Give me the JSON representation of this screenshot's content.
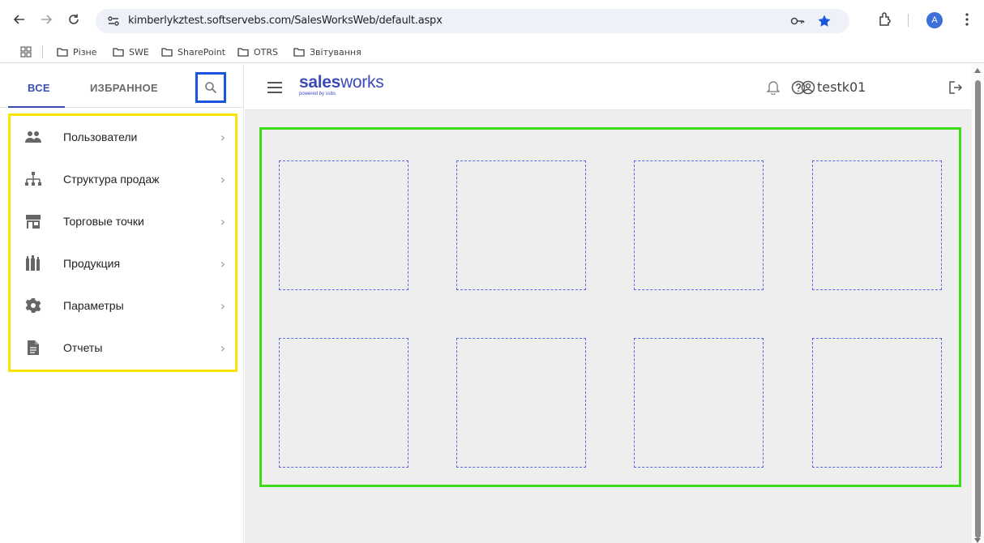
{
  "browser": {
    "url": "kimberlykztest.softservebs.com/SalesWorksWeb/default.aspx",
    "profile_initial": "A",
    "bookmarks": [
      "Різне",
      "SWE",
      "SharePoint",
      "OTRS",
      "Звітування"
    ]
  },
  "sidebar": {
    "tabs": {
      "all": "ВСЕ",
      "favorites": "ИЗБРАННОЕ"
    },
    "items": [
      {
        "label": "Пользователи",
        "icon": "users-icon"
      },
      {
        "label": "Структура продаж",
        "icon": "hierarchy-icon"
      },
      {
        "label": "Торговые точки",
        "icon": "store-icon"
      },
      {
        "label": "Продукция",
        "icon": "products-icon"
      },
      {
        "label": "Параметры",
        "icon": "gear-icon"
      },
      {
        "label": "Отчеты",
        "icon": "document-icon"
      }
    ]
  },
  "header": {
    "logo_bold": "sales",
    "logo_light": "works",
    "logo_tagline": "powered by ssbs",
    "username": "testk01"
  },
  "colors": {
    "brand": "#3a4bb8",
    "menu_highlight": "#fde400",
    "search_highlight": "#1a55e0",
    "panel_highlight": "#3fdb1a",
    "tile_border": "#5c67e6"
  }
}
